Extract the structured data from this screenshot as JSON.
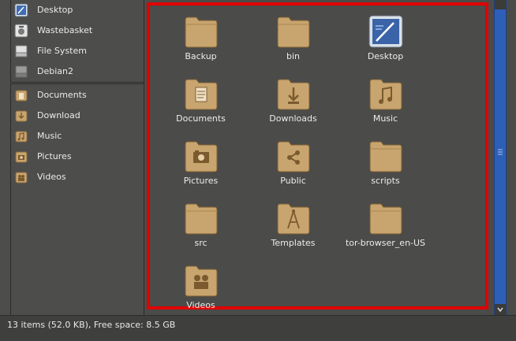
{
  "sidebar": {
    "places": [
      {
        "label": "Desktop",
        "icon": "desktop-icon"
      },
      {
        "label": "Wastebasket",
        "icon": "trash-icon"
      },
      {
        "label": "File System",
        "icon": "drive-icon"
      },
      {
        "label": "Debian2",
        "icon": "drive-icon",
        "eject": true
      }
    ],
    "bookmarks": [
      {
        "label": "Documents",
        "icon": "documents-folder-icon"
      },
      {
        "label": "Download",
        "icon": "download-folder-icon"
      },
      {
        "label": "Music",
        "icon": "music-folder-icon"
      },
      {
        "label": "Pictures",
        "icon": "pictures-folder-icon"
      },
      {
        "label": "Videos",
        "icon": "videos-folder-icon"
      }
    ]
  },
  "files": [
    {
      "label": "Backup",
      "icon": "folder-icon"
    },
    {
      "label": "bin",
      "icon": "folder-icon"
    },
    {
      "label": "Desktop",
      "icon": "desktop-icon"
    },
    {
      "label": "Documents",
      "icon": "documents-folder-icon"
    },
    {
      "label": "Downloads",
      "icon": "download-folder-icon"
    },
    {
      "label": "Music",
      "icon": "music-folder-icon"
    },
    {
      "label": "Pictures",
      "icon": "pictures-folder-icon"
    },
    {
      "label": "Public",
      "icon": "public-folder-icon"
    },
    {
      "label": "scripts",
      "icon": "folder-icon"
    },
    {
      "label": "src",
      "icon": "folder-icon"
    },
    {
      "label": "Templates",
      "icon": "templates-folder-icon"
    },
    {
      "label": "tor-browser_en-US",
      "icon": "folder-icon"
    },
    {
      "label": "Videos",
      "icon": "videos-folder-icon"
    }
  ],
  "statusbar": {
    "text": "13 items (52.0 KB), Free space: 8.5 GB"
  },
  "colors": {
    "highlight_border": "#e00000",
    "scrollbar": "#2d5fb8",
    "folder": "#c8a46e"
  }
}
